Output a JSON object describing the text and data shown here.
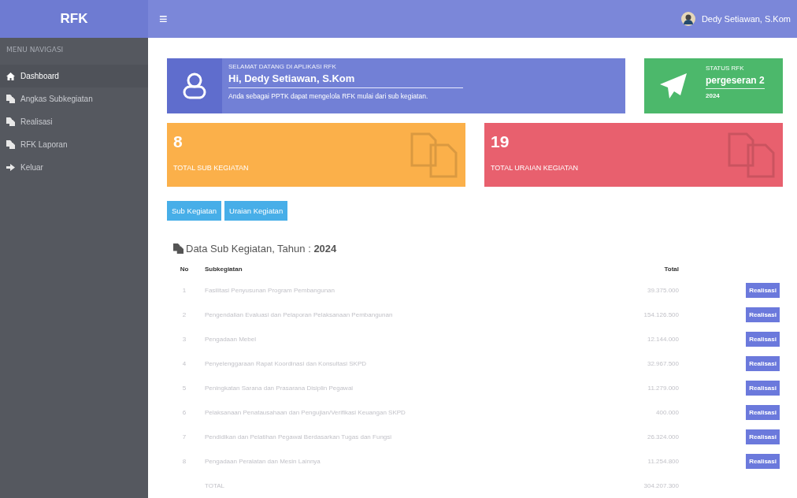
{
  "topbar": {
    "brand": "RFK",
    "menu_icon": "≡",
    "user": "Dedy Setiawan, S.Kom"
  },
  "sidebar": {
    "header": "MENU NAVIGASI",
    "items": [
      {
        "label": "Dashboard",
        "kind": "home",
        "selected": true
      },
      {
        "label": "Angkas Subkegiatan",
        "kind": "page",
        "selected": false
      },
      {
        "label": "Realisasi",
        "kind": "page",
        "selected": false
      },
      {
        "label": "RFK Laporan",
        "kind": "page",
        "selected": false
      },
      {
        "label": "Keluar",
        "kind": "exit",
        "selected": false
      }
    ]
  },
  "welcome": {
    "greeting": "SELAMAT DATANG DI APLIKASI RFK",
    "title": "Hi, Dedy Setiawan, S.Kom",
    "message": "Anda sebagai PPTK dapat mengelola RFK mulai dari sub kegiatan."
  },
  "status": {
    "label": "STATUS RFK",
    "value": "pergeseran 2",
    "year": "2024"
  },
  "stats": [
    {
      "value": "8",
      "label": "TOTAL SUB KEGIATAN",
      "color": "#fbb04a"
    },
    {
      "value": "19",
      "label": "TOTAL URAIAN KEGIATAN",
      "color": "#e8606e"
    }
  ],
  "buttons": [
    "Sub Kegiatan",
    "Uraian Kegiatan"
  ],
  "table": {
    "title": "Data Sub Kegiatan, Tahun : **2024**",
    "columns": [
      "No",
      "Subkegiatan",
      "Total"
    ],
    "rows": [
      {
        "no": "1",
        "name": "Fasilitasi Penyusunan Program Pembangunan",
        "total": "39.375.000",
        "action": "Realisasi"
      },
      {
        "no": "2",
        "name": "Pengendalian Evaluasi dan Pelaporan Pelaksanaan Pembangunan",
        "total": "154.126.500",
        "action": "Realisasi"
      },
      {
        "no": "3",
        "name": "Pengadaan Mebel",
        "total": "12.144.000",
        "action": "Realisasi"
      },
      {
        "no": "4",
        "name": "Penyelenggaraan Rapat Koordinasi dan Konsultasi SKPD",
        "total": "32.967.500",
        "action": "Realisasi"
      },
      {
        "no": "5",
        "name": "Peningkatan Sarana dan Prasarana Disiplin Pegawai",
        "total": "11.279.000",
        "action": "Realisasi"
      },
      {
        "no": "6",
        "name": "Pelaksanaan Penatausahaan dan Pengujian/Verifikasi Keuangan SKPD",
        "total": "400.000",
        "action": "Realisasi"
      },
      {
        "no": "7",
        "name": "Pendidikan dan Pelatihan Pegawai Berdasarkan Tugas dan Fungsi",
        "total": "26.324.000",
        "action": "Realisasi"
      },
      {
        "no": "8",
        "name": "Pengadaan Peralatan dan Mesin Lainnya",
        "total": "11.254.800",
        "action": "Realisasi"
      }
    ],
    "total_row": {
      "label": "TOTAL",
      "total": "304.207.300"
    }
  }
}
